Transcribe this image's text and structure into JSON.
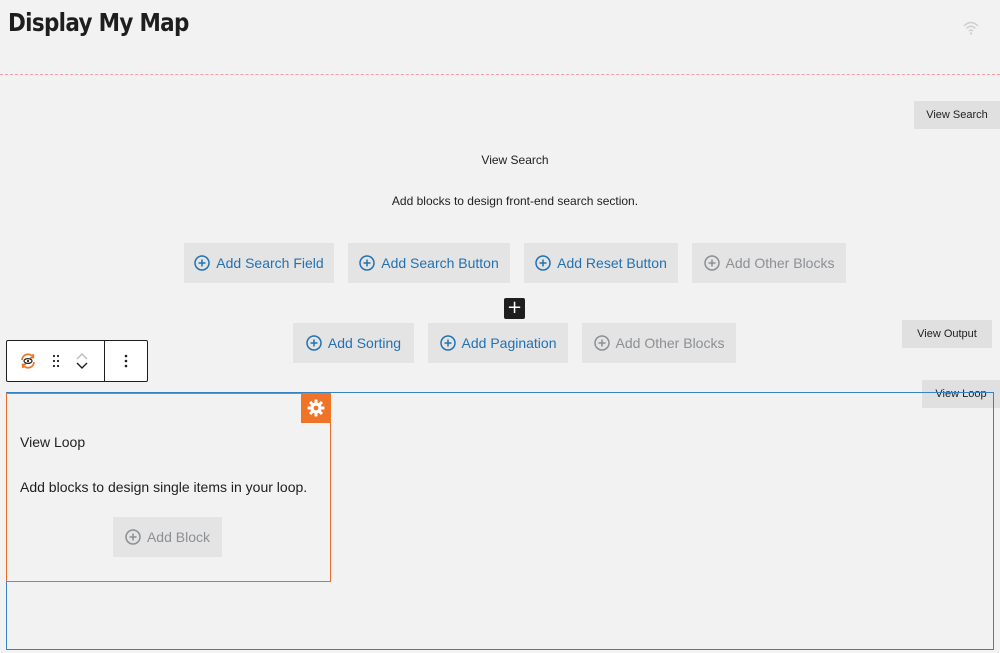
{
  "header": {
    "title": "Display My Map",
    "status_icon": "wifi-icon"
  },
  "tags": {
    "view_search": "View Search",
    "view_output": "View Output",
    "view_loop": "View Loop"
  },
  "search_section": {
    "heading": "View Search",
    "description": "Add blocks to design front-end search section.",
    "buttons": [
      {
        "label": "Add Search Field",
        "icon": "plus-circle-icon"
      },
      {
        "label": "Add Search Button",
        "icon": "plus-circle-icon"
      },
      {
        "label": "Add Reset Button",
        "icon": "plus-circle-icon"
      },
      {
        "label": "Add Other Blocks",
        "icon": "plus-circle-icon"
      }
    ]
  },
  "inserter": {
    "symbol": "+"
  },
  "output_section": {
    "buttons": [
      {
        "label": "Add Sorting",
        "icon": "plus-circle-icon"
      },
      {
        "label": "Add Pagination",
        "icon": "plus-circle-icon"
      },
      {
        "label": "Add Other Blocks",
        "icon": "plus-circle-icon"
      }
    ]
  },
  "toolbar": {
    "block_icon": "view-loop-icon",
    "drag_icon": "drag-handle-icon",
    "move_up_icon": "chevron-up-icon",
    "move_down_icon": "chevron-down-icon",
    "more_icon": "more-vertical-icon"
  },
  "loop_section": {
    "heading": "View Loop",
    "description": "Add blocks to design single items in your loop.",
    "add_block_label": "Add Block",
    "settings_icon": "gear-icon"
  },
  "colors": {
    "link_blue": "#2271b1",
    "muted_gray": "#8c8f94",
    "accent_orange": "#f07427",
    "selection_blue": "#3582c4",
    "divider_pink": "#f0a0a6"
  }
}
